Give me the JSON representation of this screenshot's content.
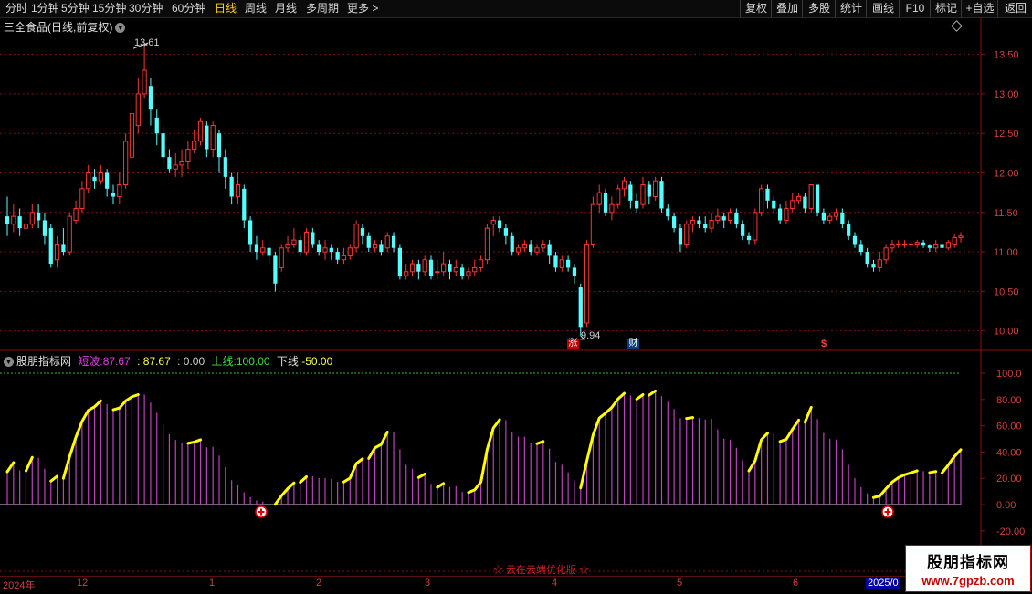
{
  "toolbar": {
    "periods": [
      "分时",
      "1分钟",
      "5分钟",
      "15分钟",
      "30分钟",
      "60分钟",
      "日线",
      "周线",
      "月线",
      "多周期",
      "更多 >"
    ],
    "active_period": "日线",
    "right_buttons": [
      "复权",
      "叠加",
      "多股",
      "统计",
      "画线",
      "F10",
      "标记",
      "+自选",
      "返回"
    ]
  },
  "main_chart": {
    "title": "三全食品(日线,前复权)",
    "high_label": "13.61",
    "low_label": "9.94",
    "markers": [
      "涨",
      "财",
      "$"
    ],
    "y_axis": [
      "13.50",
      "13.00",
      "12.50",
      "12.00",
      "11.50",
      "11.00",
      "10.50",
      "10.00"
    ]
  },
  "indicator": {
    "name": "股朋指标网",
    "short_wave_label": "短波:",
    "short_wave_value": "87.67",
    "value2": ": 87.67",
    "value3": ": 0.00",
    "upper_label": "上线:",
    "upper_value": "100.00",
    "lower_label": "下线:",
    "lower_value": "-50.00",
    "y_axis": [
      "100.0",
      "80.00",
      "60.00",
      "40.00",
      "20.00",
      "0.00",
      "-20.00"
    ]
  },
  "bottom_note": "☆ 云在云端优化版 ☆",
  "date_axis": [
    "2024年",
    "12",
    "1",
    "2",
    "3",
    "4",
    "5",
    "6",
    "2025/0"
  ],
  "watermark": {
    "line1": "股朋指标网",
    "line2": "www.7gpzb.com"
  },
  "colors": {
    "up": "#ff3232",
    "down": "#54ffff",
    "bars": "#c040c0",
    "highlight": "#ffff00"
  },
  "chart_data": {
    "type": "candlestick",
    "ylim": [
      9.8,
      13.9
    ],
    "high": 13.61,
    "low": 9.94,
    "candles": [
      [
        11.45,
        11.35,
        11.7,
        11.2
      ],
      [
        11.35,
        11.45,
        11.6,
        11.25
      ],
      [
        11.45,
        11.3,
        11.55,
        11.2
      ],
      [
        11.3,
        11.35,
        11.5,
        11.25
      ],
      [
        11.35,
        11.5,
        11.6,
        11.3
      ],
      [
        11.5,
        11.4,
        11.6,
        11.3
      ],
      [
        11.4,
        11.2,
        11.5,
        11.1
      ],
      [
        11.3,
        10.85,
        11.35,
        10.8
      ],
      [
        10.9,
        11.1,
        11.2,
        10.8
      ],
      [
        11.1,
        11.0,
        11.3,
        10.95
      ],
      [
        11.0,
        11.45,
        11.5,
        10.95
      ],
      [
        11.4,
        11.55,
        11.65,
        11.35
      ],
      [
        11.55,
        11.8,
        11.9,
        11.5
      ],
      [
        11.8,
        12.0,
        12.1,
        11.75
      ],
      [
        11.95,
        11.9,
        12.05,
        11.8
      ],
      [
        11.9,
        12.0,
        12.1,
        11.85
      ],
      [
        12.0,
        11.8,
        12.05,
        11.7
      ],
      [
        11.75,
        11.7,
        11.85,
        11.6
      ],
      [
        11.7,
        11.85,
        12.0,
        11.6
      ],
      [
        11.85,
        12.4,
        12.5,
        11.8
      ],
      [
        12.2,
        12.75,
        12.9,
        12.1
      ],
      [
        12.6,
        13.0,
        13.2,
        12.5
      ],
      [
        13.0,
        13.3,
        13.61,
        12.95
      ],
      [
        13.1,
        12.8,
        13.2,
        12.6
      ],
      [
        12.7,
        12.5,
        12.8,
        12.35
      ],
      [
        12.5,
        12.2,
        12.6,
        12.1
      ],
      [
        12.2,
        12.05,
        12.3,
        12.0
      ],
      [
        12.05,
        12.1,
        12.25,
        11.95
      ],
      [
        12.1,
        12.15,
        12.3,
        11.95
      ],
      [
        12.15,
        12.3,
        12.4,
        12.05
      ],
      [
        12.3,
        12.4,
        12.55,
        12.25
      ],
      [
        12.4,
        12.65,
        12.7,
        12.35
      ],
      [
        12.6,
        12.3,
        12.65,
        12.2
      ],
      [
        12.3,
        12.6,
        12.65,
        12.2
      ],
      [
        12.5,
        12.2,
        12.55,
        12.0
      ],
      [
        12.2,
        11.95,
        12.3,
        11.8
      ],
      [
        11.95,
        11.7,
        12.0,
        11.6
      ],
      [
        11.7,
        11.85,
        12.0,
        11.6
      ],
      [
        11.8,
        11.4,
        11.85,
        11.3
      ],
      [
        11.4,
        11.1,
        11.45,
        11.0
      ],
      [
        11.1,
        11.0,
        11.2,
        10.9
      ],
      [
        11.0,
        11.05,
        11.15,
        10.95
      ],
      [
        11.05,
        10.95,
        11.1,
        10.85
      ],
      [
        10.95,
        10.6,
        11.0,
        10.5
      ],
      [
        10.8,
        11.05,
        11.1,
        10.75
      ],
      [
        11.05,
        11.1,
        11.2,
        11.0
      ],
      [
        11.1,
        11.15,
        11.3,
        11.05
      ],
      [
        11.15,
        11.0,
        11.2,
        10.95
      ],
      [
        11.0,
        11.25,
        11.3,
        10.95
      ],
      [
        11.25,
        11.1,
        11.3,
        11.05
      ],
      [
        11.1,
        11.0,
        11.15,
        10.95
      ],
      [
        11.0,
        11.05,
        11.15,
        10.9
      ],
      [
        11.05,
        11.0,
        11.1,
        10.9
      ],
      [
        11.0,
        10.9,
        11.05,
        10.85
      ],
      [
        10.9,
        10.95,
        11.05,
        10.85
      ],
      [
        10.95,
        11.05,
        11.1,
        10.9
      ],
      [
        11.05,
        11.35,
        11.4,
        11.0
      ],
      [
        11.3,
        11.2,
        11.35,
        11.1
      ],
      [
        11.2,
        11.05,
        11.25,
        11.0
      ],
      [
        11.05,
        11.1,
        11.15,
        11.0
      ],
      [
        11.1,
        11.0,
        11.15,
        10.95
      ],
      [
        11.05,
        11.2,
        11.25,
        11.0
      ],
      [
        11.2,
        11.05,
        11.25,
        11.0
      ],
      [
        11.05,
        10.7,
        11.1,
        10.65
      ],
      [
        10.7,
        10.75,
        10.85,
        10.65
      ],
      [
        10.75,
        10.85,
        10.9,
        10.7
      ],
      [
        10.85,
        10.75,
        10.9,
        10.65
      ],
      [
        10.75,
        10.9,
        10.95,
        10.7
      ],
      [
        10.9,
        10.7,
        10.95,
        10.65
      ],
      [
        10.75,
        10.75,
        10.9,
        10.65
      ],
      [
        10.75,
        10.85,
        11.0,
        10.7
      ],
      [
        10.85,
        10.75,
        10.9,
        10.65
      ],
      [
        10.75,
        10.8,
        10.9,
        10.7
      ],
      [
        10.8,
        10.7,
        10.85,
        10.65
      ],
      [
        10.7,
        10.75,
        10.8,
        10.65
      ],
      [
        10.75,
        10.8,
        10.9,
        10.7
      ],
      [
        10.8,
        10.9,
        10.95,
        10.75
      ],
      [
        10.9,
        11.3,
        11.35,
        10.85
      ],
      [
        11.35,
        11.4,
        11.45,
        11.2
      ],
      [
        11.4,
        11.3,
        11.45,
        11.25
      ],
      [
        11.3,
        11.2,
        11.35,
        11.1
      ],
      [
        11.2,
        11.0,
        11.25,
        10.95
      ],
      [
        11.0,
        11.05,
        11.1,
        10.95
      ],
      [
        11.05,
        11.1,
        11.15,
        11.0
      ],
      [
        11.1,
        11.0,
        11.15,
        10.95
      ],
      [
        11.0,
        11.05,
        11.1,
        10.95
      ],
      [
        11.05,
        11.1,
        11.15,
        11.0
      ],
      [
        11.1,
        10.95,
        11.15,
        10.85
      ],
      [
        10.95,
        10.8,
        11.0,
        10.75
      ],
      [
        10.8,
        10.9,
        10.95,
        10.75
      ],
      [
        10.9,
        10.8,
        10.95,
        10.75
      ],
      [
        10.8,
        10.7,
        10.85,
        10.6
      ],
      [
        10.55,
        10.05,
        10.6,
        9.94
      ],
      [
        10.1,
        11.1,
        11.15,
        10.05
      ],
      [
        11.1,
        11.6,
        11.7,
        11.05
      ],
      [
        11.6,
        11.75,
        11.85,
        11.5
      ],
      [
        11.75,
        11.5,
        11.8,
        11.45
      ],
      [
        11.5,
        11.6,
        11.7,
        11.4
      ],
      [
        11.6,
        11.8,
        11.85,
        11.55
      ],
      [
        11.8,
        11.9,
        11.95,
        11.7
      ],
      [
        11.85,
        11.65,
        11.9,
        11.55
      ],
      [
        11.65,
        11.55,
        11.75,
        11.5
      ],
      [
        11.6,
        11.85,
        11.95,
        11.55
      ],
      [
        11.85,
        11.7,
        11.9,
        11.6
      ],
      [
        11.7,
        11.9,
        11.95,
        11.65
      ],
      [
        11.9,
        11.55,
        11.95,
        11.5
      ],
      [
        11.55,
        11.45,
        11.6,
        11.4
      ],
      [
        11.45,
        11.3,
        11.5,
        11.25
      ],
      [
        11.3,
        11.1,
        11.35,
        11.0
      ],
      [
        11.1,
        11.35,
        11.4,
        11.05
      ],
      [
        11.35,
        11.4,
        11.45,
        11.25
      ],
      [
        11.4,
        11.35,
        11.45,
        11.3
      ],
      [
        11.35,
        11.3,
        11.45,
        11.25
      ],
      [
        11.3,
        11.4,
        11.5,
        11.25
      ],
      [
        11.4,
        11.45,
        11.55,
        11.35
      ],
      [
        11.45,
        11.4,
        11.5,
        11.3
      ],
      [
        11.4,
        11.5,
        11.55,
        11.35
      ],
      [
        11.5,
        11.35,
        11.55,
        11.3
      ],
      [
        11.35,
        11.2,
        11.4,
        11.15
      ],
      [
        11.2,
        11.15,
        11.25,
        11.1
      ],
      [
        11.15,
        11.5,
        11.55,
        11.1
      ],
      [
        11.5,
        11.8,
        11.85,
        11.45
      ],
      [
        11.8,
        11.65,
        11.85,
        11.55
      ],
      [
        11.65,
        11.55,
        11.7,
        11.5
      ],
      [
        11.55,
        11.4,
        11.6,
        11.35
      ],
      [
        11.4,
        11.55,
        11.65,
        11.35
      ],
      [
        11.55,
        11.65,
        11.75,
        11.5
      ],
      [
        11.65,
        11.7,
        11.75,
        11.6
      ],
      [
        11.7,
        11.55,
        11.75,
        11.5
      ],
      [
        11.55,
        11.85,
        11.85,
        11.5
      ],
      [
        11.85,
        11.5,
        11.85,
        11.45
      ],
      [
        11.5,
        11.4,
        11.55,
        11.35
      ],
      [
        11.4,
        11.45,
        11.5,
        11.35
      ],
      [
        11.45,
        11.5,
        11.55,
        11.4
      ],
      [
        11.5,
        11.35,
        11.55,
        11.3
      ],
      [
        11.35,
        11.2,
        11.4,
        11.15
      ],
      [
        11.2,
        11.1,
        11.25,
        11.05
      ],
      [
        11.1,
        11.0,
        11.15,
        10.95
      ],
      [
        11.0,
        10.85,
        11.05,
        10.8
      ],
      [
        10.85,
        10.8,
        10.9,
        10.75
      ],
      [
        10.8,
        10.9,
        11.0,
        10.75
      ],
      [
        10.9,
        11.05,
        11.1,
        10.85
      ],
      [
        11.05,
        11.1,
        11.15,
        11.0
      ],
      [
        11.1,
        11.1,
        11.15,
        11.05
      ],
      [
        11.1,
        11.1,
        11.15,
        11.05
      ],
      [
        11.1,
        11.1,
        11.15,
        11.05
      ],
      [
        11.1,
        11.12,
        11.15,
        11.05
      ],
      [
        11.12,
        11.08,
        11.15,
        11.05
      ],
      [
        11.08,
        11.05,
        11.1,
        11.0
      ],
      [
        11.05,
        11.1,
        11.15,
        11.0
      ],
      [
        11.1,
        11.05,
        11.1,
        11.0
      ],
      [
        11.05,
        11.12,
        11.15,
        11.02
      ],
      [
        11.1,
        11.18,
        11.22,
        11.05
      ],
      [
        11.18,
        11.2,
        11.25,
        11.12
      ]
    ]
  }
}
